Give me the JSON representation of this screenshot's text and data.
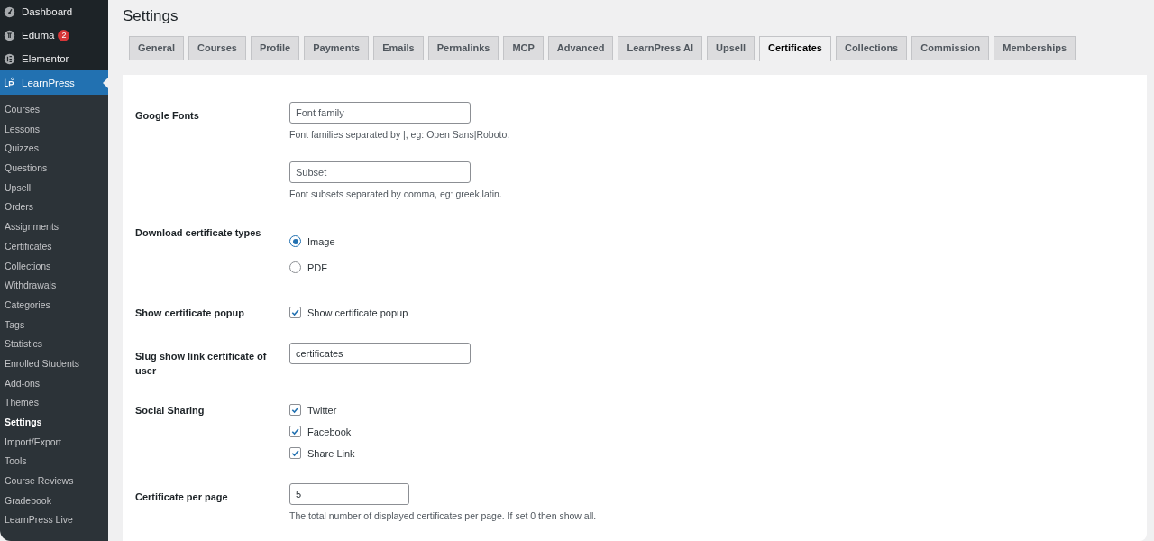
{
  "sidebar": {
    "menu": [
      {
        "label": "Dashboard",
        "current": false
      },
      {
        "label": "Eduma",
        "badge": "2",
        "current": false
      },
      {
        "label": "Elementor",
        "current": false
      },
      {
        "label": "LearnPress",
        "current": true
      }
    ],
    "submenu": [
      {
        "label": "Courses",
        "selected": false
      },
      {
        "label": "Lessons",
        "selected": false
      },
      {
        "label": "Quizzes",
        "selected": false
      },
      {
        "label": "Questions",
        "selected": false
      },
      {
        "label": "Upsell",
        "selected": false
      },
      {
        "label": "Orders",
        "selected": false
      },
      {
        "label": "Assignments",
        "selected": false
      },
      {
        "label": "Certificates",
        "selected": false
      },
      {
        "label": "Collections",
        "selected": false
      },
      {
        "label": "Withdrawals",
        "selected": false
      },
      {
        "label": "Categories",
        "selected": false
      },
      {
        "label": "Tags",
        "selected": false
      },
      {
        "label": "Statistics",
        "selected": false
      },
      {
        "label": "Enrolled Students",
        "selected": false
      },
      {
        "label": "Add-ons",
        "selected": false
      },
      {
        "label": "Themes",
        "selected": false
      },
      {
        "label": "Settings",
        "selected": true
      },
      {
        "label": "Import/Export",
        "selected": false
      },
      {
        "label": "Tools",
        "selected": false
      },
      {
        "label": "Course Reviews",
        "selected": false
      },
      {
        "label": "Gradebook",
        "selected": false
      },
      {
        "label": "LearnPress Live",
        "selected": false
      }
    ]
  },
  "page_title": "Settings",
  "tabs": [
    {
      "label": "General",
      "selected": false
    },
    {
      "label": "Courses",
      "selected": false
    },
    {
      "label": "Profile",
      "selected": false
    },
    {
      "label": "Payments",
      "selected": false
    },
    {
      "label": "Emails",
      "selected": false
    },
    {
      "label": "Permalinks",
      "selected": false
    },
    {
      "label": "MCP",
      "selected": false
    },
    {
      "label": "Advanced",
      "selected": false
    },
    {
      "label": "LearnPress AI",
      "selected": false
    },
    {
      "label": "Upsell",
      "selected": false
    },
    {
      "label": "Certificates",
      "selected": true
    },
    {
      "label": "Collections",
      "selected": false
    },
    {
      "label": "Commission",
      "selected": false
    },
    {
      "label": "Memberships",
      "selected": false
    }
  ],
  "settings": [
    {
      "kind": "fields",
      "label": "Google Fonts",
      "fields": [
        {
          "placeholder": "Font family",
          "description": "Font families separated by |, eg: Open Sans|Roboto."
        },
        {
          "placeholder": "Subset",
          "description": "Font subsets separated by comma, eg: greek,latin."
        }
      ]
    },
    {
      "kind": "radios",
      "label": "Download certificate types",
      "options": [
        {
          "label": "Image",
          "selected": true
        },
        {
          "label": "PDF",
          "selected": false
        }
      ]
    },
    {
      "kind": "checkboxes",
      "label": "Show certificate popup",
      "options": [
        {
          "label": "Show certificate popup",
          "checked": true
        }
      ]
    },
    {
      "kind": "fields",
      "label": "Slug show link certificate of user",
      "fields": [
        {
          "value": "certificates"
        }
      ]
    },
    {
      "kind": "checkboxes",
      "label": "Social Sharing",
      "options": [
        {
          "label": "Twitter",
          "checked": true
        },
        {
          "label": "Facebook",
          "checked": true
        },
        {
          "label": "Share Link",
          "checked": true
        }
      ]
    },
    {
      "kind": "number",
      "label": "Certificate per page",
      "fields": [
        {
          "value": "5",
          "description": "The total number of displayed certificates per page. If set 0 then show all."
        }
      ]
    }
  ]
}
